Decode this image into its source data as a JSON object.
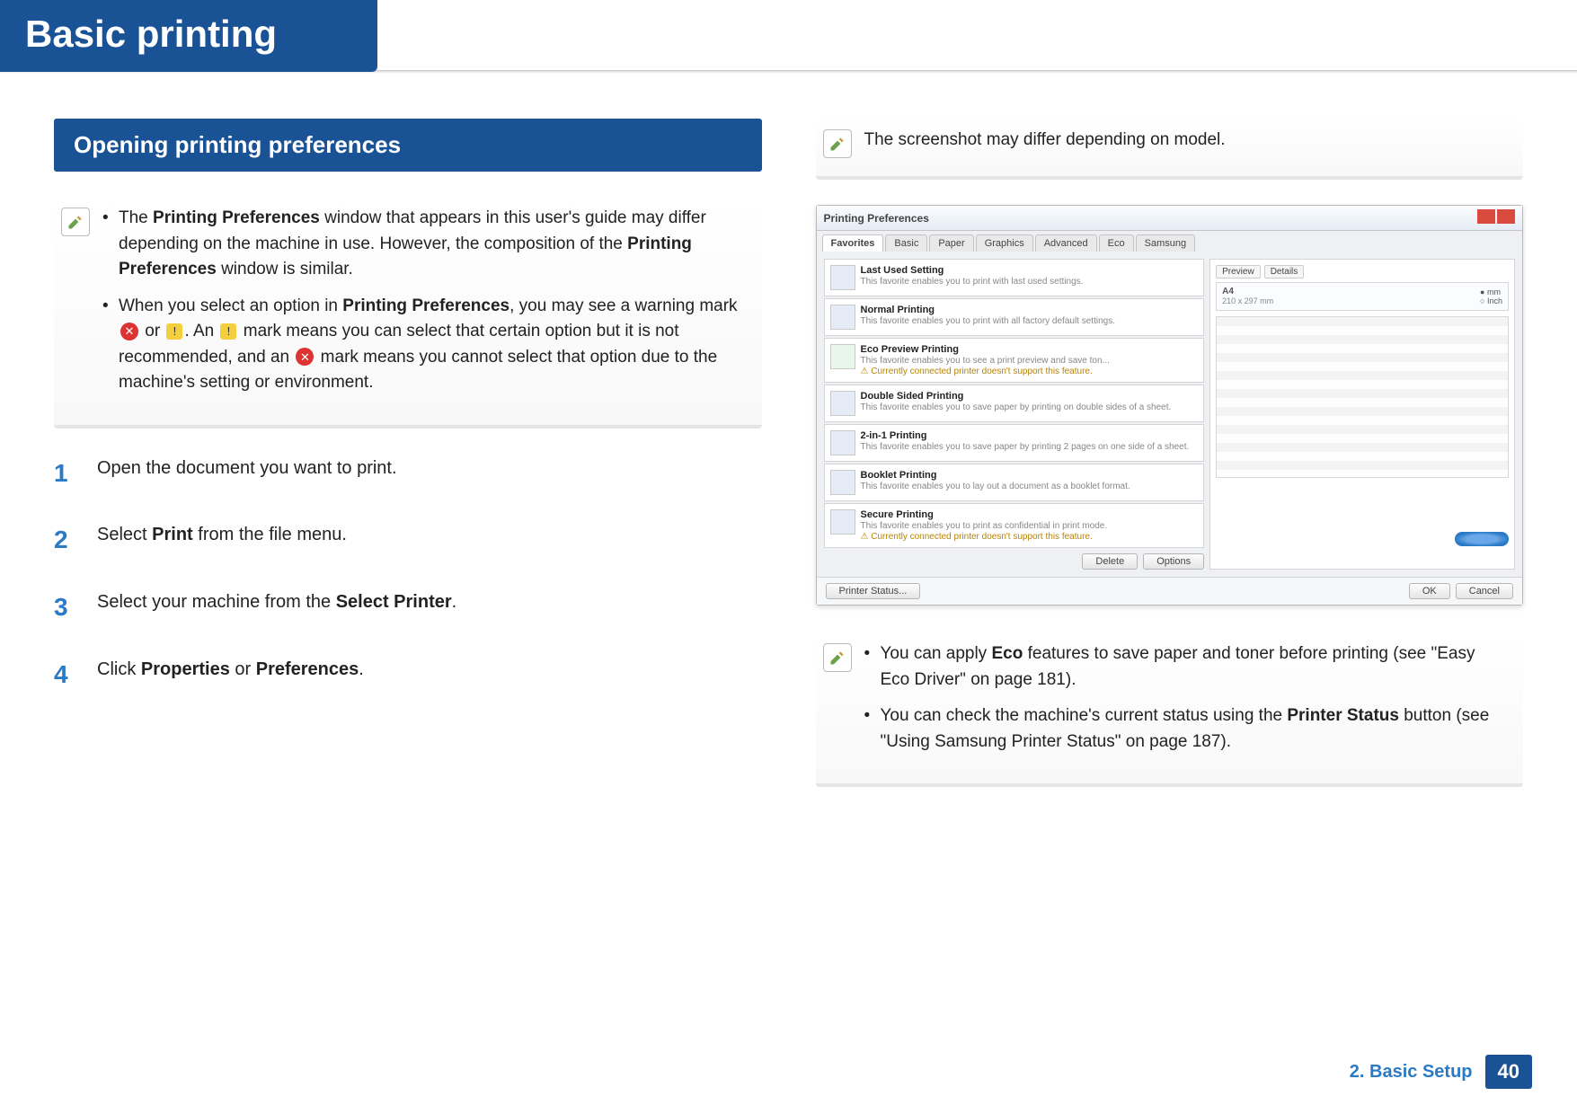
{
  "header": {
    "title": "Basic printing"
  },
  "left": {
    "section_title": "Opening printing preferences",
    "note1": {
      "items": [
        {
          "pre": "The ",
          "b1": "Printing Preferences",
          "mid": " window that appears in this user's guide may differ depending on the machine in use. However, the composition of the ",
          "b2": "Printing Preferences",
          "post": " window is similar."
        },
        {
          "pre": "When you select an option in ",
          "b1": "Printing Preferences",
          "mid": ", you may see a warning mark ",
          "or": " or ",
          "mid2": ". An ",
          "mid3": " mark means you can select that certain option but it is not recommended, and an ",
          "mid4": " mark means you cannot select that option due to the machine's setting or environment."
        }
      ]
    },
    "steps": [
      {
        "n": "1",
        "pre": "Open the document you want to print."
      },
      {
        "n": "2",
        "pre": "Select ",
        "b": "Print",
        "post": " from the file menu."
      },
      {
        "n": "3",
        "pre": "Select your machine from the ",
        "b": "Select Printer",
        "post": "."
      },
      {
        "n": "4",
        "pre": "Click ",
        "b": "Properties",
        "mid": " or ",
        "b2": "Preferences",
        "post": "."
      }
    ]
  },
  "right": {
    "top_note": "The screenshot may differ depending on model.",
    "ss": {
      "title": "Printing Preferences",
      "tabs": [
        "Favorites",
        "Basic",
        "Paper",
        "Graphics",
        "Advanced",
        "Eco",
        "Samsung"
      ],
      "rows": [
        {
          "t": "Last Used Setting",
          "s": "This favorite enables you to print with last used settings."
        },
        {
          "t": "Normal Printing",
          "s": "This favorite enables you to print with all factory default settings."
        },
        {
          "t": "Eco Preview Printing",
          "s": "This favorite enables you to see a print preview and save ton...",
          "w": "Currently connected printer doesn't support this feature."
        },
        {
          "t": "Double Sided Printing",
          "s": "This favorite enables you to save paper by printing on double sides of a sheet."
        },
        {
          "t": "2-in-1 Printing",
          "s": "This favorite enables you to save paper by printing 2 pages on one side of a sheet."
        },
        {
          "t": "Booklet Printing",
          "s": "This favorite enables you to lay out a document as a booklet format."
        },
        {
          "t": "Secure Printing",
          "s": "This favorite enables you to print as confidential in print mode.",
          "w": "Currently connected printer doesn't support this feature."
        }
      ],
      "row_btns": {
        "delete": "Delete",
        "options": "Options"
      },
      "preview": {
        "tab1": "Preview",
        "tab2": "Details",
        "paper": "A4",
        "dim": "210 x 297 mm",
        "unit1": "mm",
        "unit2": "Inch"
      },
      "status_btn": "Printer Status...",
      "ok": "OK",
      "cancel": "Cancel"
    },
    "note2": {
      "items": [
        {
          "pre": "You can apply ",
          "b": "Eco",
          "post": " features to save paper and toner before printing (see \"Easy Eco Driver\" on page 181)."
        },
        {
          "pre": "You can check the machine's current status using the ",
          "b": "Printer Status",
          "post": " button (see \"Using Samsung Printer Status\" on page 187)."
        }
      ]
    }
  },
  "footer": {
    "chapter": "2. Basic Setup",
    "page": "40"
  }
}
